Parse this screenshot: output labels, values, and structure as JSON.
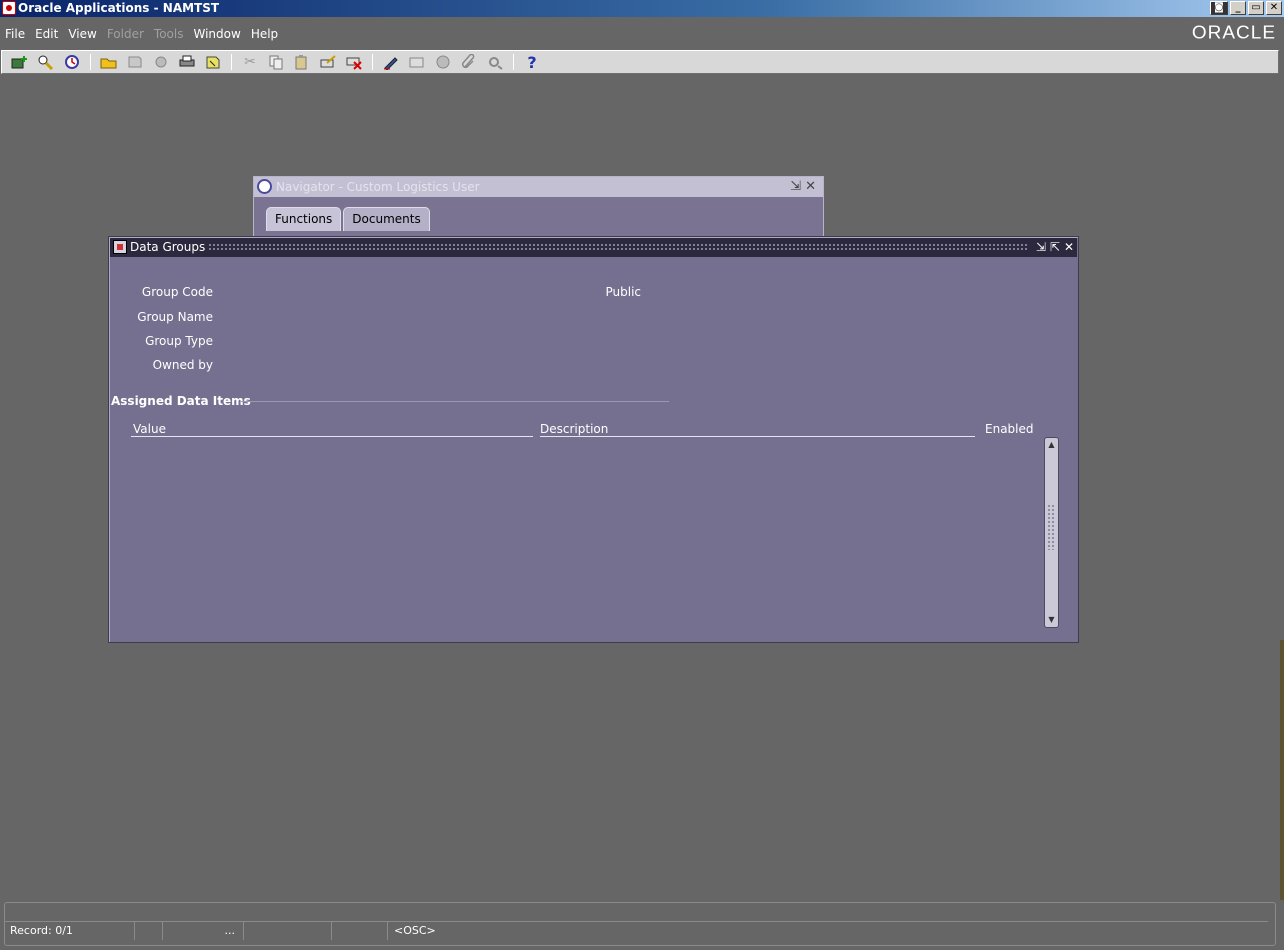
{
  "window": {
    "title": "Oracle Applications - NAMTST",
    "controls": [
      "_",
      "▭",
      "✕"
    ]
  },
  "menu": {
    "items": [
      {
        "label": "File",
        "enabled": true
      },
      {
        "label": "Edit",
        "enabled": true
      },
      {
        "label": "View",
        "enabled": true
      },
      {
        "label": "Folder",
        "enabled": false
      },
      {
        "label": "Tools",
        "enabled": false
      },
      {
        "label": "Window",
        "enabled": true
      },
      {
        "label": "Help",
        "enabled": true
      }
    ],
    "brand": "ORACLE"
  },
  "toolbar": {
    "icons": [
      "new-record-icon",
      "find-icon",
      "navigator-icon",
      "open-folder-icon",
      "save-icon",
      "next-step-icon",
      "print-icon",
      "close-form-icon",
      "cut-icon",
      "copy-icon",
      "paste-icon",
      "clear-record-icon",
      "delete-record-icon",
      "edit-field-icon",
      "zoom-icon",
      "translations-icon",
      "attachments-icon",
      "folder-tools-icon",
      "help-icon"
    ],
    "help_label": "?"
  },
  "navigator": {
    "title": "Navigator - Custom Logistics User",
    "tabs": [
      {
        "label": "Functions",
        "active": true
      },
      {
        "label": "Documents",
        "active": false
      }
    ]
  },
  "data_groups": {
    "title": "Data Groups",
    "fields": {
      "group_code": "Group Code",
      "public": "Public",
      "group_name": "Group Name",
      "group_type": "Group Type",
      "owned_by": "Owned by"
    },
    "section_title": "Assigned Data Items",
    "columns": {
      "value": "Value",
      "description": "Description",
      "enabled": "Enabled"
    }
  },
  "status": {
    "record": "Record: 0/1",
    "ellipsis": "...",
    "mode": "<OSC>"
  }
}
